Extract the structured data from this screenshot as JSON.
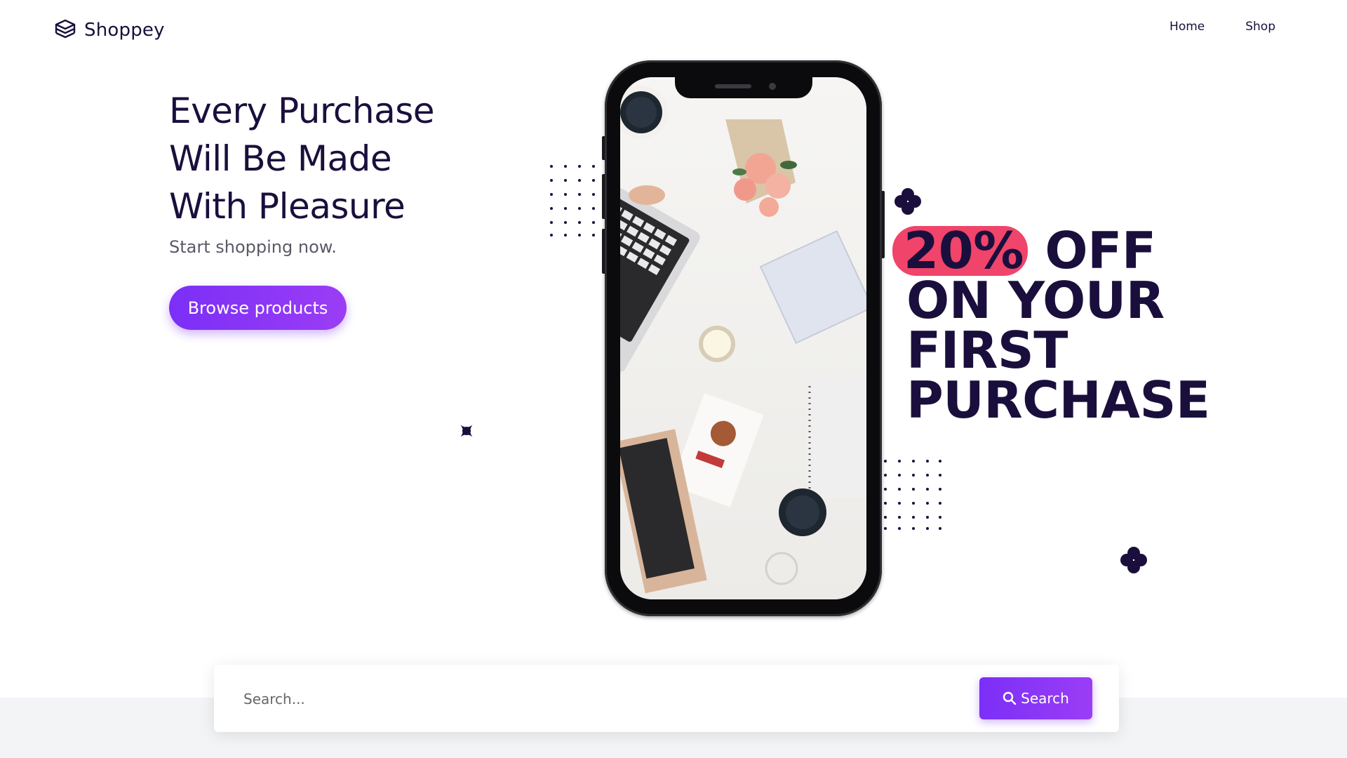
{
  "header": {
    "brand": "Shoppey",
    "logo_icon": "stacked-layers-icon",
    "nav": [
      {
        "label": "Home"
      },
      {
        "label": "Shop"
      }
    ]
  },
  "hero": {
    "title_lines": [
      "Every Purchase",
      "Will Be Made",
      "With Pleasure"
    ],
    "subtitle": "Start shopping now.",
    "cta_label": "Browse products"
  },
  "promo": {
    "highlight": "20%",
    "line1_rest": "OFF",
    "line2": "ON YOUR",
    "line3": "FIRST",
    "line4": "PURCHASE"
  },
  "search": {
    "placeholder": "Search...",
    "button_label": "Search",
    "button_icon": "search-icon"
  },
  "colors": {
    "brand_dark": "#1a0f3c",
    "accent_purple": "#7b2ff7",
    "highlight_pink": "#f0446a",
    "band_grey": "#f3f4f6"
  }
}
